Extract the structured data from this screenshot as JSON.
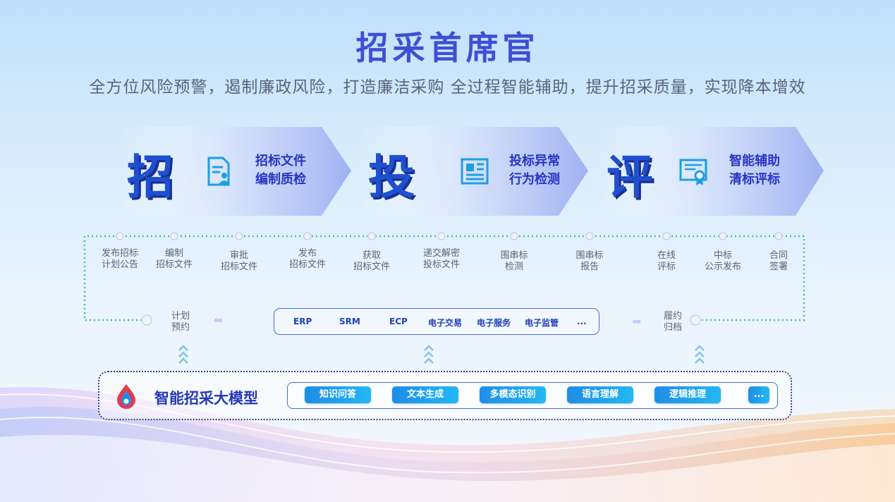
{
  "header": {
    "title": "招采首席官",
    "subtitle": "全方位风险预警，遏制廉政风险，打造廉洁采购  全过程智能辅助，提升招采质量，实现降本增效"
  },
  "banners": [
    {
      "char": "招",
      "icon": "document-user-icon",
      "line1": "招标文件",
      "line2": "编制质检"
    },
    {
      "char": "投",
      "icon": "newspaper-icon",
      "line1": "投标异常",
      "line2": "行为检测"
    },
    {
      "char": "评",
      "icon": "certificate-icon",
      "line1": "智能辅助",
      "line2": "清标评标"
    }
  ],
  "flow_steps": [
    {
      "line1": "发布招标",
      "line2": "计划公告"
    },
    {
      "line1": "编制",
      "line2": "招标文件"
    },
    {
      "line1": "审批",
      "line2": "招标文件"
    },
    {
      "line1": "发布",
      "line2": "招标文件"
    },
    {
      "line1": "获取",
      "line2": "招标文件"
    },
    {
      "line1": "递交解密",
      "line2": "投标文件"
    },
    {
      "line1": "围串标",
      "line2": "检测"
    },
    {
      "line1": "围串标",
      "line2": "报告"
    },
    {
      "line1": "在线",
      "line2": "评标"
    },
    {
      "line1": "中标",
      "line2": "公示发布"
    },
    {
      "line1": "合同",
      "line2": "签署"
    }
  ],
  "flow_left": {
    "line1": "计划",
    "line2": "预约"
  },
  "flow_right": {
    "line1": "履约",
    "line2": "归档"
  },
  "systems": [
    "ERP",
    "SRM",
    "ECP",
    "电子交易",
    "电子服务",
    "电子监管",
    "..."
  ],
  "model": {
    "title": "智能招采大模型",
    "capabilities": [
      "知识问答",
      "文本生成",
      "多模态识别",
      "语言理解",
      "逻辑推理",
      "..."
    ]
  },
  "colors": {
    "primary": "#2a33c2",
    "accent": "#1f8de6",
    "dotted_line": "#3fb7d4"
  }
}
